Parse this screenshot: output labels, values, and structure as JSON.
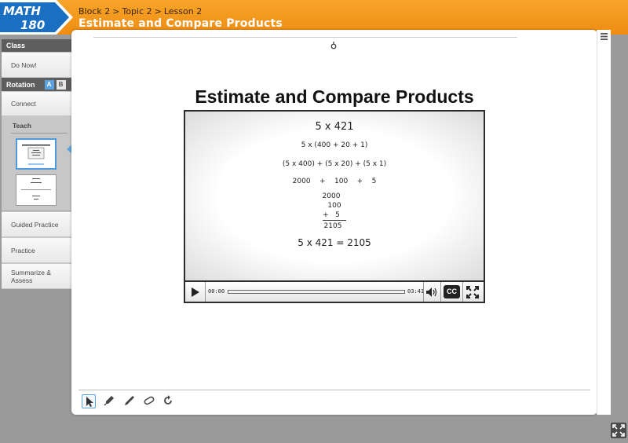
{
  "logo": {
    "text_top": "MATH",
    "text_bottom": "180"
  },
  "header": {
    "breadcrumb": [
      "Block 2",
      "Topic 2",
      "Lesson 2"
    ],
    "breadcrumb_separator": ">",
    "lesson_title": "Estimate and Compare Products"
  },
  "sidebar": {
    "class_label": "Class",
    "do_now": "Do Now!",
    "rotation_label": "Rotation",
    "rotation_a": "A",
    "rotation_b": "B",
    "connect": "Connect",
    "teach": "Teach",
    "guided_practice": "Guided Practice",
    "practice": "Practice",
    "summarize_line1": "Summarize &",
    "summarize_line2": "Assess"
  },
  "slide": {
    "title": "Estimate and Compare Products",
    "math_lines": [
      "5 x 421",
      "5 x (400 + 20 + 1)",
      "(5 x 400) + (5 x 20) + (5 x 1)",
      "2000    +    100    +    5",
      "2000",
      "100",
      "+   5",
      "2105",
      "5 x 421 = 2105"
    ]
  },
  "video": {
    "current_time": "00:00",
    "duration": "03:41",
    "progress": 0,
    "cc_label": "CC"
  },
  "toolbar": {
    "tools": [
      "pointer-icon",
      "marker-icon",
      "pencil-icon",
      "eraser-icon",
      "redo-icon"
    ]
  },
  "colors": {
    "header_orange": "#f39a1e",
    "accent_blue": "#5aa3e0",
    "sidebar_dark": "#5e5e5e"
  }
}
